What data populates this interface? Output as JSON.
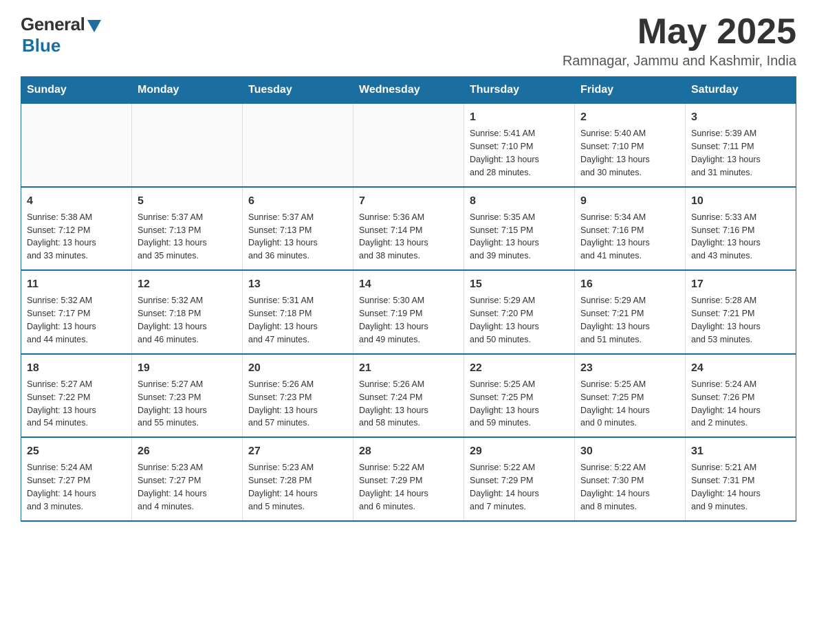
{
  "header": {
    "logo_general": "General",
    "logo_blue": "Blue",
    "month_year": "May 2025",
    "location": "Ramnagar, Jammu and Kashmir, India"
  },
  "weekdays": [
    "Sunday",
    "Monday",
    "Tuesday",
    "Wednesday",
    "Thursday",
    "Friday",
    "Saturday"
  ],
  "weeks": [
    [
      {
        "day": "",
        "info": ""
      },
      {
        "day": "",
        "info": ""
      },
      {
        "day": "",
        "info": ""
      },
      {
        "day": "",
        "info": ""
      },
      {
        "day": "1",
        "info": "Sunrise: 5:41 AM\nSunset: 7:10 PM\nDaylight: 13 hours\nand 28 minutes."
      },
      {
        "day": "2",
        "info": "Sunrise: 5:40 AM\nSunset: 7:10 PM\nDaylight: 13 hours\nand 30 minutes."
      },
      {
        "day": "3",
        "info": "Sunrise: 5:39 AM\nSunset: 7:11 PM\nDaylight: 13 hours\nand 31 minutes."
      }
    ],
    [
      {
        "day": "4",
        "info": "Sunrise: 5:38 AM\nSunset: 7:12 PM\nDaylight: 13 hours\nand 33 minutes."
      },
      {
        "day": "5",
        "info": "Sunrise: 5:37 AM\nSunset: 7:13 PM\nDaylight: 13 hours\nand 35 minutes."
      },
      {
        "day": "6",
        "info": "Sunrise: 5:37 AM\nSunset: 7:13 PM\nDaylight: 13 hours\nand 36 minutes."
      },
      {
        "day": "7",
        "info": "Sunrise: 5:36 AM\nSunset: 7:14 PM\nDaylight: 13 hours\nand 38 minutes."
      },
      {
        "day": "8",
        "info": "Sunrise: 5:35 AM\nSunset: 7:15 PM\nDaylight: 13 hours\nand 39 minutes."
      },
      {
        "day": "9",
        "info": "Sunrise: 5:34 AM\nSunset: 7:16 PM\nDaylight: 13 hours\nand 41 minutes."
      },
      {
        "day": "10",
        "info": "Sunrise: 5:33 AM\nSunset: 7:16 PM\nDaylight: 13 hours\nand 43 minutes."
      }
    ],
    [
      {
        "day": "11",
        "info": "Sunrise: 5:32 AM\nSunset: 7:17 PM\nDaylight: 13 hours\nand 44 minutes."
      },
      {
        "day": "12",
        "info": "Sunrise: 5:32 AM\nSunset: 7:18 PM\nDaylight: 13 hours\nand 46 minutes."
      },
      {
        "day": "13",
        "info": "Sunrise: 5:31 AM\nSunset: 7:18 PM\nDaylight: 13 hours\nand 47 minutes."
      },
      {
        "day": "14",
        "info": "Sunrise: 5:30 AM\nSunset: 7:19 PM\nDaylight: 13 hours\nand 49 minutes."
      },
      {
        "day": "15",
        "info": "Sunrise: 5:29 AM\nSunset: 7:20 PM\nDaylight: 13 hours\nand 50 minutes."
      },
      {
        "day": "16",
        "info": "Sunrise: 5:29 AM\nSunset: 7:21 PM\nDaylight: 13 hours\nand 51 minutes."
      },
      {
        "day": "17",
        "info": "Sunrise: 5:28 AM\nSunset: 7:21 PM\nDaylight: 13 hours\nand 53 minutes."
      }
    ],
    [
      {
        "day": "18",
        "info": "Sunrise: 5:27 AM\nSunset: 7:22 PM\nDaylight: 13 hours\nand 54 minutes."
      },
      {
        "day": "19",
        "info": "Sunrise: 5:27 AM\nSunset: 7:23 PM\nDaylight: 13 hours\nand 55 minutes."
      },
      {
        "day": "20",
        "info": "Sunrise: 5:26 AM\nSunset: 7:23 PM\nDaylight: 13 hours\nand 57 minutes."
      },
      {
        "day": "21",
        "info": "Sunrise: 5:26 AM\nSunset: 7:24 PM\nDaylight: 13 hours\nand 58 minutes."
      },
      {
        "day": "22",
        "info": "Sunrise: 5:25 AM\nSunset: 7:25 PM\nDaylight: 13 hours\nand 59 minutes."
      },
      {
        "day": "23",
        "info": "Sunrise: 5:25 AM\nSunset: 7:25 PM\nDaylight: 14 hours\nand 0 minutes."
      },
      {
        "day": "24",
        "info": "Sunrise: 5:24 AM\nSunset: 7:26 PM\nDaylight: 14 hours\nand 2 minutes."
      }
    ],
    [
      {
        "day": "25",
        "info": "Sunrise: 5:24 AM\nSunset: 7:27 PM\nDaylight: 14 hours\nand 3 minutes."
      },
      {
        "day": "26",
        "info": "Sunrise: 5:23 AM\nSunset: 7:27 PM\nDaylight: 14 hours\nand 4 minutes."
      },
      {
        "day": "27",
        "info": "Sunrise: 5:23 AM\nSunset: 7:28 PM\nDaylight: 14 hours\nand 5 minutes."
      },
      {
        "day": "28",
        "info": "Sunrise: 5:22 AM\nSunset: 7:29 PM\nDaylight: 14 hours\nand 6 minutes."
      },
      {
        "day": "29",
        "info": "Sunrise: 5:22 AM\nSunset: 7:29 PM\nDaylight: 14 hours\nand 7 minutes."
      },
      {
        "day": "30",
        "info": "Sunrise: 5:22 AM\nSunset: 7:30 PM\nDaylight: 14 hours\nand 8 minutes."
      },
      {
        "day": "31",
        "info": "Sunrise: 5:21 AM\nSunset: 7:31 PM\nDaylight: 14 hours\nand 9 minutes."
      }
    ]
  ]
}
